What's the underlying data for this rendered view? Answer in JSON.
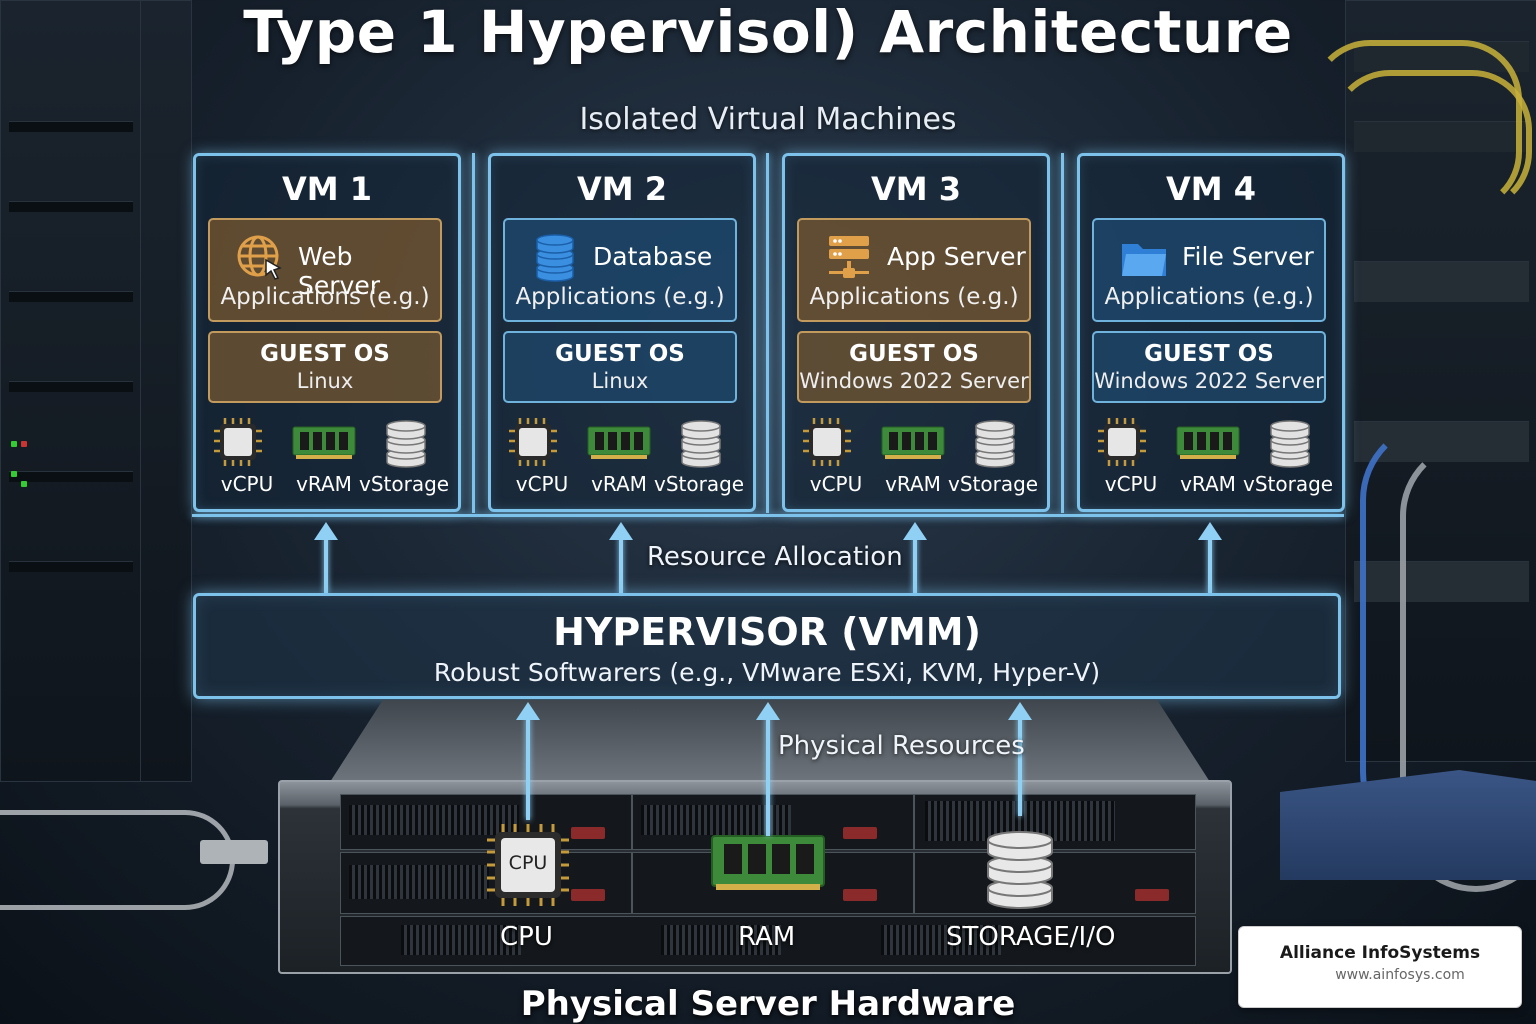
{
  "title": "Type 1 Hypervisol) Architecture",
  "subtitle": "Isolated Virtual Machines",
  "vms": [
    {
      "name": "VM 1",
      "app": "Web Server",
      "app_sub": "Applications (e.g.)",
      "app_icon": "globe-cursor-icon",
      "os_title": "GUEST OS",
      "os": "Linux",
      "theme": "brown"
    },
    {
      "name": "VM 2",
      "app": "Database",
      "app_sub": "Applications (e.g.)",
      "app_icon": "database-icon",
      "os_title": "GUEST OS",
      "os": "Linux",
      "theme": "blue"
    },
    {
      "name": "VM 3",
      "app": "App Server",
      "app_sub": "Applications (e.g.)",
      "app_icon": "server-network-icon",
      "os_title": "GUEST OS",
      "os": "Windows 2022 Server",
      "theme": "brown"
    },
    {
      "name": "VM 4",
      "app": "File Server",
      "app_sub": "Applications (e.g.)",
      "app_icon": "folder-icon",
      "os_title": "GUEST OS",
      "os": "Windows 2022 Server",
      "theme": "blue"
    }
  ],
  "vm_resources": [
    "vCPU",
    "vRAM",
    "vStorage"
  ],
  "resource_allocation": "Resource Allocation",
  "hypervisor": {
    "title": "HYPERVISOR (VMM)",
    "subtitle": "Robust Softwarers (e.g., VMware ESXi, KVM, Hyper-V)"
  },
  "physical_resources": "Physical Resources",
  "hardware": {
    "cpu_chip": "CPU",
    "cpu": "CPU",
    "ram": "RAM",
    "storage": "STORAGE/I/O"
  },
  "footer": "Physical Server Hardware",
  "badge": {
    "name": "Alliance InfoSystems",
    "url": "www.ainfosys.com"
  },
  "colors": {
    "glow": "#7cc2ea",
    "brown_box": "#c29a5e",
    "blue_box": "#6fb2dc"
  }
}
